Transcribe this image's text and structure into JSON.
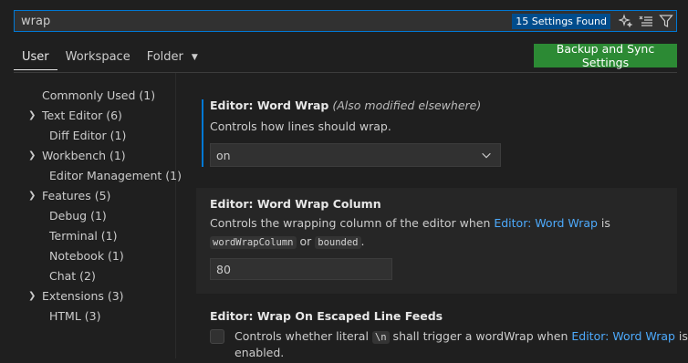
{
  "search": {
    "value": "wrap",
    "results_badge": "15 Settings Found"
  },
  "tabs": [
    {
      "label": "User"
    },
    {
      "label": "Workspace"
    },
    {
      "label": "Folder"
    }
  ],
  "sync_button": "Backup and Sync Settings",
  "toc": [
    {
      "label": "Commonly Used (1)"
    },
    {
      "label": "Text Editor (6)"
    },
    {
      "label": "Diff Editor (1)"
    },
    {
      "label": "Workbench (1)"
    },
    {
      "label": "Editor Management (1)"
    },
    {
      "label": "Features (5)"
    },
    {
      "label": "Debug (1)"
    },
    {
      "label": "Terminal (1)"
    },
    {
      "label": "Notebook (1)"
    },
    {
      "label": "Chat (2)"
    },
    {
      "label": "Extensions (3)"
    },
    {
      "label": "HTML (3)"
    }
  ],
  "settings": {
    "word_wrap": {
      "category": "Editor: ",
      "name": "Word Wrap",
      "modified": "(Also modified elsewhere)",
      "description": "Controls how lines should wrap.",
      "value": "on"
    },
    "word_wrap_column": {
      "category": "Editor: ",
      "name": "Word Wrap Column",
      "desc_part1": "Controls the wrapping column of the editor when ",
      "desc_link": "Editor: Word Wrap",
      "desc_part2": " is",
      "code1": "wordWrapColumn",
      "desc_or": " or ",
      "code2": "bounded",
      "desc_end": ".",
      "value": "80"
    },
    "wrap_escaped": {
      "category": "Editor: ",
      "name": "Wrap On Escaped Line Feeds",
      "desc_part1": "Controls whether literal ",
      "code": "\\n",
      "desc_part2": " shall trigger a wordWrap when ",
      "desc_link": "Editor: Word Wrap",
      "desc_part3": " is",
      "desc_line2": "enabled."
    }
  }
}
